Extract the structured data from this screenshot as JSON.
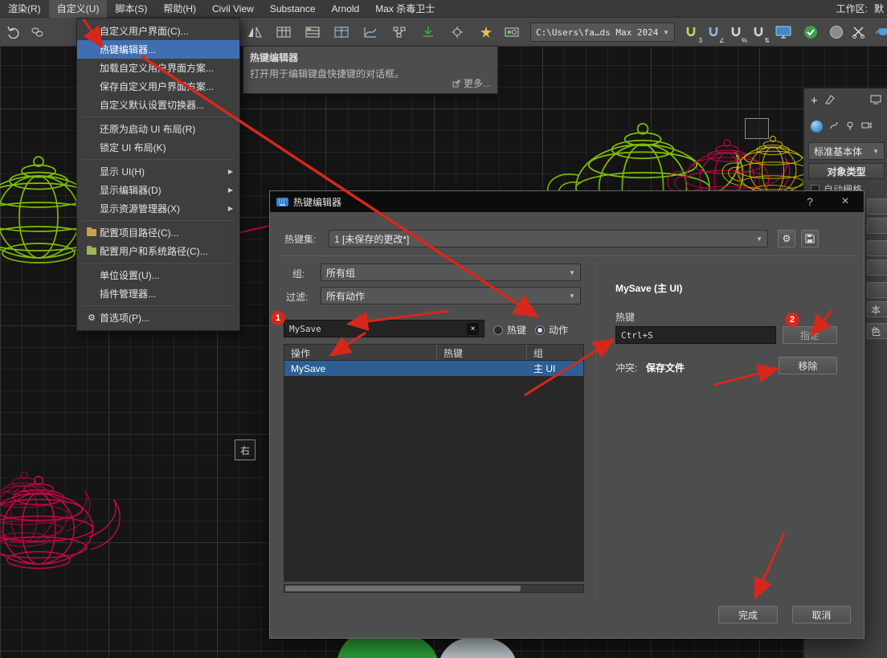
{
  "colors": {
    "annotation_red": "#d6281a",
    "menu_highlight_blue": "#3f6fb2",
    "selected_row_blue": "#2d5e94",
    "accent_blue": "#4a9fe0",
    "check_green": "#3f9f46",
    "teapot_green": "#7fbf00",
    "teapot_magenta": "#c2084a",
    "teapot_yellow": "#d0c400"
  },
  "menu_bar": {
    "items": [
      {
        "label": "渲染(R)"
      },
      {
        "label": "自定义(U)"
      },
      {
        "label": "脚本(S)"
      },
      {
        "label": "帮助(H)"
      },
      {
        "label": "Civil View"
      },
      {
        "label": "Substance"
      },
      {
        "label": "Arnold"
      },
      {
        "label": "Max 杀毒卫士"
      }
    ],
    "workspace_label": "工作区:",
    "workspace_value": "默"
  },
  "customize_menu": {
    "items": [
      {
        "label": "自定义用户界面(C)..."
      },
      {
        "label": "热键编辑器..."
      },
      {
        "label": "加载自定义用户界面方案..."
      },
      {
        "label": "保存自定义用户界面方案..."
      },
      {
        "label": "自定义默认设置切换器..."
      },
      {
        "label": "还原为启动 UI 布局(R)"
      },
      {
        "label": "锁定 UI 布局(K)"
      },
      {
        "label": "显示 UI(H)"
      },
      {
        "label": "显示编辑器(D)"
      },
      {
        "label": "显示资源管理器(X)"
      },
      {
        "label": "配置项目路径(C)..."
      },
      {
        "label": "配置用户和系统路径(C)..."
      },
      {
        "label": "单位设置(U)..."
      },
      {
        "label": "插件管理器..."
      },
      {
        "label": "首选项(P)..."
      }
    ]
  },
  "tooltip": {
    "title": "热键编辑器",
    "body": "打开用于编辑键盘快捷键的对话框。",
    "more": "更多..."
  },
  "toolbar": {
    "path_value": "C:\\Users\\fa…ds Max 2024",
    "snap_labels": [
      "3",
      "∠",
      "%",
      "⇅"
    ]
  },
  "dialog": {
    "title": "热键编辑器",
    "help_button": "?",
    "close_button": "×",
    "hotkey_set_label": "热键集:",
    "hotkey_set_value": "1 [未保存的更改*]",
    "group_label": "组:",
    "group_value": "所有组",
    "filter_label": "过滤:",
    "filter_value": "所有动作",
    "search_value": "MySave",
    "radio_hotkey": "热键",
    "radio_action": "动作",
    "table": {
      "headers": [
        "操作",
        "热键",
        "组"
      ],
      "rows": [
        {
          "action": "MySave",
          "hotkey": "",
          "group": "主 UI"
        }
      ]
    },
    "selection_title": "MySave (主 UI)",
    "hotkey_label": "热键",
    "hotkey_value": "Ctrl+S",
    "assign_button": "指定",
    "conflict_label": "冲突:",
    "conflict_value": "保存文件",
    "remove_button": "移除",
    "done_button": "完成",
    "cancel_button": "取消"
  },
  "command_panel": {
    "category_value": "标准基本体",
    "rollout_title": "对象类型",
    "autogrid_label": "自动栅格",
    "fragments": [
      "本",
      "色"
    ]
  },
  "viewport": {
    "view_label": "右"
  },
  "annotations": {
    "badge_1": "1",
    "badge_2": "2"
  }
}
